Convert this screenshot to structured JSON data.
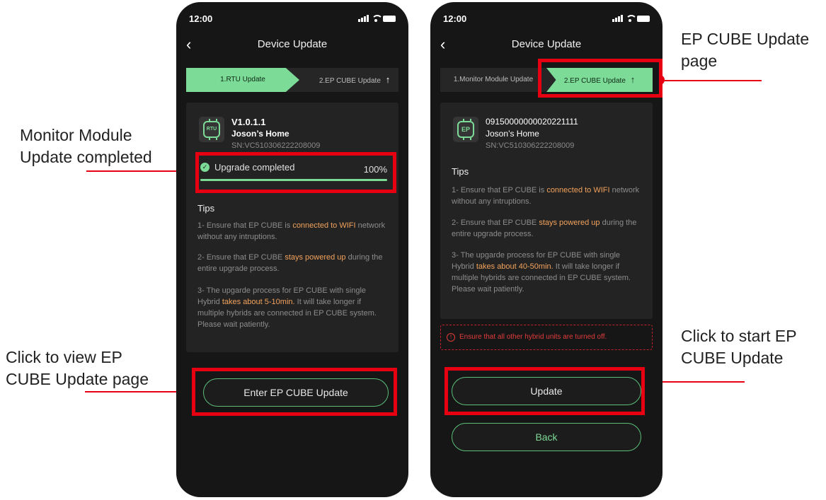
{
  "annotations": {
    "monitor_done": [
      "Monitor Module",
      "Update completed"
    ],
    "view_ep": [
      "Click to view EP",
      "CUBE Update page"
    ],
    "ep_page": [
      "EP CUBE Update",
      "page"
    ],
    "start_ep": [
      "Click to start EP",
      "CUBE Update"
    ]
  },
  "colors": {
    "accent": "#7cdb96",
    "highlight": "#f2a25c",
    "annotation": "#e60012",
    "warning": "#e23b3b"
  },
  "left_phone": {
    "status_time": "12:00",
    "nav_title": "Device Update",
    "steps": [
      "1.RTU Update",
      "2.EP CUBE Update"
    ],
    "step_arrow_icon": "arrow-up-icon",
    "device": {
      "icon_text": "RTU",
      "version": "V1.0.1.1",
      "name": "Joson’s Home",
      "sn": "SN:VC510306222208009"
    },
    "progress": {
      "label": "Upgrade completed",
      "value_text": "100%",
      "value": 1.0
    },
    "tips_title": "Tips",
    "tips": [
      {
        "pre": "1- Ensure that EP CUBE is ",
        "hl": "connected to WIFI",
        "post": " network without any intruptions."
      },
      {
        "pre": "2- Ensure that EP CUBE ",
        "hl": "stays powered up",
        "post": " during the entire upgrade process."
      },
      {
        "pre": "3- The upgarde process for EP CUBE with single Hybrid ",
        "hl": "takes about 5-10min.",
        "post": " It will take longer if multiple hybrids are connected in EP CUBE system. Please wait patiently."
      }
    ],
    "button": "Enter EP CUBE Update"
  },
  "right_phone": {
    "status_time": "12:00",
    "nav_title": "Device Update",
    "steps": [
      "1.Monitor Module Update",
      "2.EP CUBE Update"
    ],
    "step_arrow_icon": "arrow-up-icon",
    "device": {
      "icon_text": "EP",
      "version": "09150000000020221111",
      "name": "Joson’s Home",
      "sn": "SN:VC510306222208009"
    },
    "tips_title": "Tips",
    "tips": [
      {
        "pre": "1- Ensure that EP CUBE is ",
        "hl": "connected to WIFI",
        "post": " network without any intruptions."
      },
      {
        "pre": "2- Ensure that EP CUBE ",
        "hl": "stays powered up",
        "post": " during the entire upgrade process."
      },
      {
        "pre": "3- The upgarde process for EP CUBE with single Hybrid ",
        "hl": "takes about 40-50min.",
        "post": " It will take longer if multiple hybrids are connected in EP CUBE system. Please wait patiently."
      }
    ],
    "warning": "Ensure that all other hybrid units are turned off.",
    "buttons": [
      "Update",
      "Back"
    ]
  }
}
